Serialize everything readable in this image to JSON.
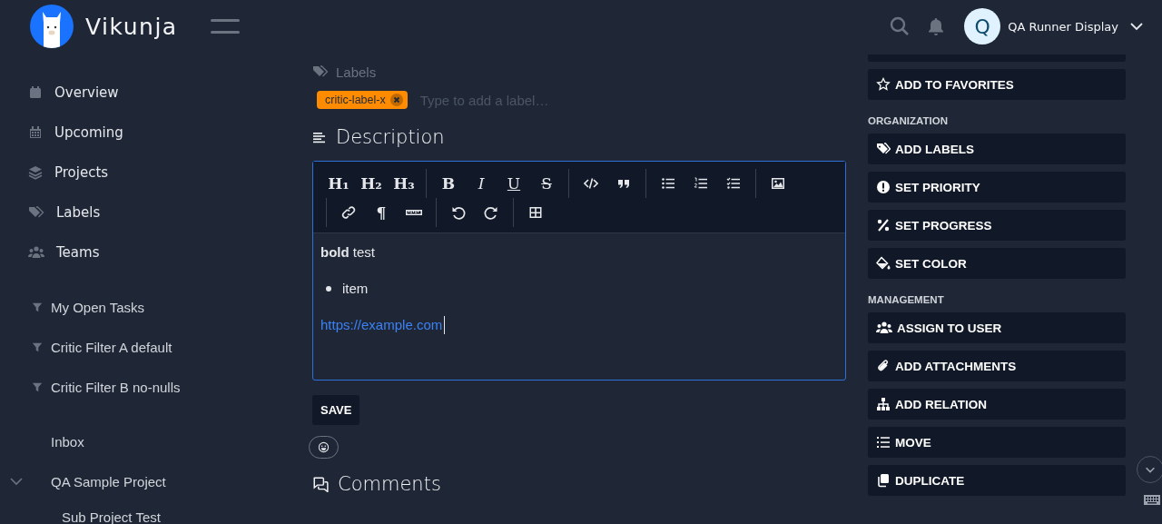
{
  "header": {
    "app_name": "Vikunja",
    "user": {
      "initial": "Q",
      "name": "QA Runner Display"
    }
  },
  "sidebar": {
    "nav": [
      {
        "label": "Overview"
      },
      {
        "label": "Upcoming"
      },
      {
        "label": "Projects"
      },
      {
        "label": "Labels"
      },
      {
        "label": "Teams"
      }
    ],
    "filters": [
      {
        "label": "My Open Tasks"
      },
      {
        "label": "Critic Filter A default"
      },
      {
        "label": "Critic Filter B no-nulls"
      }
    ],
    "projects": [
      {
        "label": "Inbox"
      },
      {
        "label": "QA Sample Project",
        "expanded": true,
        "children": [
          {
            "label": "Sub Project Test"
          }
        ]
      }
    ]
  },
  "task": {
    "labels_heading": "Labels",
    "labels": [
      {
        "text": "critic-label-x",
        "color": "#ff8c00"
      }
    ],
    "label_input": {
      "placeholder": "Type to add a label…"
    },
    "description": {
      "heading": "Description",
      "toolbar": [
        [
          [
            {
              "kind": "heading",
              "text": "H₁"
            },
            {
              "kind": "heading",
              "text": "H₂"
            },
            {
              "kind": "heading",
              "text": "H₃"
            }
          ],
          [
            {
              "kind": "bold",
              "text": "B"
            },
            {
              "kind": "italic",
              "text": "I"
            },
            {
              "kind": "underline",
              "text": "U"
            },
            {
              "kind": "strike",
              "text": "S"
            }
          ],
          [
            {
              "kind": "icon"
            },
            {
              "kind": "icon"
            }
          ],
          [
            {
              "kind": "icon"
            },
            {
              "kind": "icon"
            },
            {
              "kind": "icon"
            }
          ],
          [
            {
              "kind": "icon"
            }
          ]
        ],
        [
          [
            {
              "kind": "icon"
            },
            {
              "kind": "bold",
              "text": "¶"
            },
            {
              "kind": "icon"
            }
          ],
          [
            {
              "kind": "icon"
            },
            {
              "kind": "icon"
            }
          ],
          [
            {
              "kind": "icon"
            }
          ]
        ]
      ],
      "content": [
        {
          "kind": "paragraph",
          "text": "**bold** test"
        },
        {
          "kind": "bullet",
          "text": "item"
        },
        {
          "kind": "link",
          "text": "https://example.com",
          "cursor": true
        }
      ],
      "save": "SAVE"
    },
    "comments_heading": "Comments"
  },
  "actions": [
    {
      "kind": "button",
      "label": "ADD TO FAVORITES"
    },
    {
      "kind": "heading",
      "label": "ORGANIZATION"
    },
    {
      "kind": "button",
      "label": "ADD LABELS"
    },
    {
      "kind": "button",
      "label": "SET PRIORITY"
    },
    {
      "kind": "button",
      "label": "SET PROGRESS"
    },
    {
      "kind": "button",
      "label": "SET COLOR"
    },
    {
      "kind": "heading",
      "label": "MANAGEMENT"
    },
    {
      "kind": "button",
      "label": "ASSIGN TO USER"
    },
    {
      "kind": "button",
      "label": "ADD ATTACHMENTS"
    },
    {
      "kind": "button",
      "label": "ADD RELATION"
    },
    {
      "kind": "button",
      "label": "MOVE"
    },
    {
      "kind": "button",
      "label": "DUPLICATE"
    }
  ]
}
